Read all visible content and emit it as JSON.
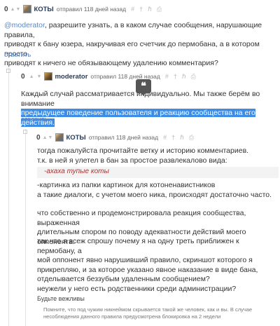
{
  "comment1": {
    "rating": "0",
    "username": "КОТЫ",
    "meta": "отправил 118 дней назад",
    "actions": [
      "#",
      "†",
      "ℏ",
      "⎙"
    ],
    "mention": "@moderator",
    "text_line1_rest": ", разрешите узнать, а в каком случае сообщения, нарушающие правила,",
    "text_line2": "приводят к бану юзера, накручивая его счетчик до пермобана, а в котором просто",
    "text_line3": "приводят к ничего не обязывающему удалению комментария?",
    "reply_label": "ответить"
  },
  "comment2": {
    "rating": "0",
    "username": "moderator",
    "meta": "отправил 118 дней назад",
    "actions": [
      "#",
      "†",
      "ℏ",
      "⎙"
    ],
    "line1": "Каждый случай рассматривается индивидуально. Мы также берём во внимание",
    "line2_selected": "предыдущее поведение пользователя и реакцию сообщества на его действия.",
    "reply_label": "ответить",
    "quote_icon": "❝"
  },
  "comment3": {
    "rating": "0",
    "username": "КОТЫ",
    "meta": "отправил 118 дней назад",
    "actions": [
      "#",
      "†",
      "ℏ",
      "⎙"
    ],
    "p1_l1": "тогда пожалуйста прочитайте ветку и историю комментариев.",
    "p1_l2": "т.к. в ней я улетел в бан за простое развлекалово вида:",
    "quote": "-ахаха тупые коты",
    "p2_l1": "-картинка из папки картинок для котоненавистников",
    "p2_l2": "а такие диалоги, с учетом моего ника, происходят достаточно часто.",
    "p3_l1": "что собственно и продемонстрировала реакция сообщества, выраженная",
    "p3_l2": "длительным спором по поводу адекватности действий моего оппонента.",
    "p4_l1": "так что я всеж спрошу почему я на одну треть приближен к пермобану, а",
    "p4_l2": "мой оппонент явно нарушивший правило, скриншот которого я",
    "p4_l3": "прикрепляю, и за которое указано явное наказание в виде бана,",
    "p4_l4": "отделывается беззубым удаленным сообщением?",
    "p5": "неужели у него есть родственники среди администрации?",
    "rule_title": "Будьте вежливы",
    "rule_l1": "Помните, что под чужим никнеймом скрывается такой же человек, как и вы. В случае",
    "rule_l2": "несоблюдения данного правила предусмотрена блокировка на 2 недели"
  }
}
